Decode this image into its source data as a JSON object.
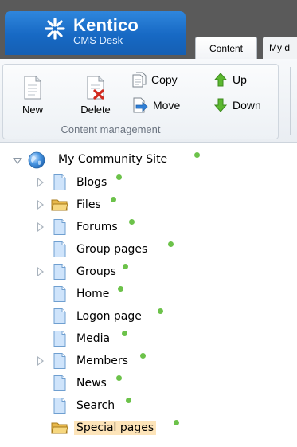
{
  "header": {
    "logo_title": "Kentico",
    "logo_subtitle": "CMS Desk",
    "tabs": [
      {
        "label": "Content",
        "active": true
      },
      {
        "label": "My d",
        "active": false
      }
    ]
  },
  "toolbar": {
    "new_label": "New",
    "delete_label": "Delete",
    "copy_label": "Copy",
    "move_label": "Move",
    "up_label": "Up",
    "down_label": "Down",
    "group_caption": "Content management"
  },
  "tree": {
    "root": {
      "label": "My Community Site",
      "icon": "globe-icon",
      "expanded": true,
      "status": "published"
    },
    "items": [
      {
        "label": "Blogs",
        "icon": "page-icon",
        "expandable": true,
        "selected": false
      },
      {
        "label": "Files",
        "icon": "folder-icon",
        "expandable": true,
        "selected": false
      },
      {
        "label": "Forums",
        "icon": "page-icon",
        "expandable": true,
        "selected": false
      },
      {
        "label": "Group pages",
        "icon": "page-icon",
        "expandable": false,
        "selected": false
      },
      {
        "label": "Groups",
        "icon": "page-icon",
        "expandable": true,
        "selected": false
      },
      {
        "label": "Home",
        "icon": "page-icon",
        "expandable": false,
        "selected": false
      },
      {
        "label": "Logon page",
        "icon": "page-icon",
        "expandable": false,
        "selected": false
      },
      {
        "label": "Media",
        "icon": "page-icon",
        "expandable": false,
        "selected": false
      },
      {
        "label": "Members",
        "icon": "page-icon",
        "expandable": true,
        "selected": false
      },
      {
        "label": "News",
        "icon": "page-icon",
        "expandable": false,
        "selected": false
      },
      {
        "label": "Search",
        "icon": "page-icon",
        "expandable": false,
        "selected": false
      },
      {
        "label": "Special pages",
        "icon": "folder-icon",
        "expandable": false,
        "selected": true
      }
    ]
  },
  "colors": {
    "header_bg": "#5a5a5a",
    "logo_blue": "#1769c4",
    "status_green": "#6cc24a",
    "selection_bg": "#fde4b9"
  }
}
